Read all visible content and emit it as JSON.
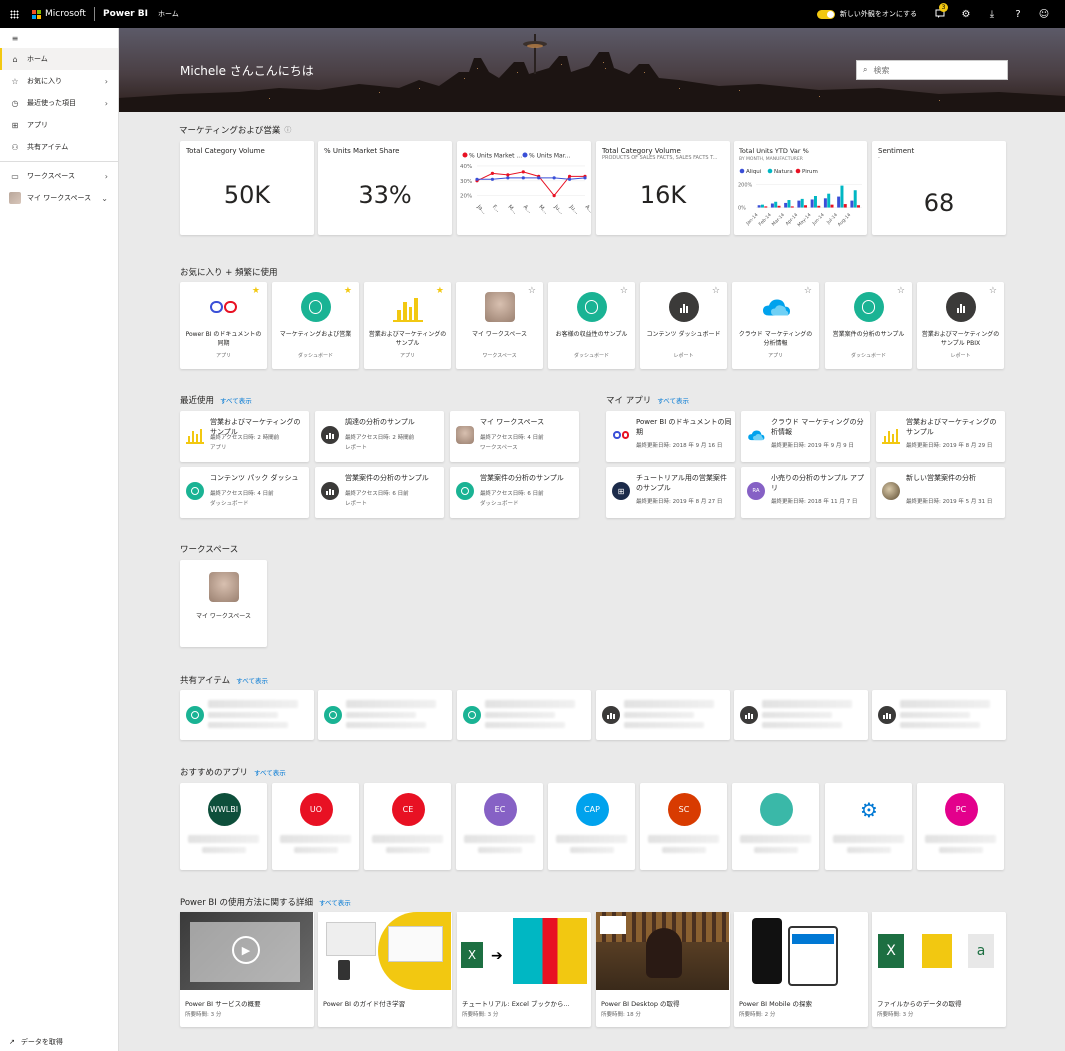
{
  "topbar": {
    "brand": "Microsoft",
    "product": "Power BI",
    "location": "ホーム",
    "new_look_label": "新しい外観をオンにする",
    "notification_count": "3"
  },
  "sidebar": {
    "items": [
      {
        "label": "ホーム",
        "icon": "home-icon"
      },
      {
        "label": "お気に入り",
        "icon": "star-icon"
      },
      {
        "label": "最近使った項目",
        "icon": "clock-icon"
      },
      {
        "label": "アプリ",
        "icon": "apps-icon"
      },
      {
        "label": "共有アイテム",
        "icon": "shared-icon"
      },
      {
        "label": "ワークスペース",
        "icon": "workspace-icon"
      },
      {
        "label": "マイ ワークスペース",
        "icon": "avatar"
      }
    ],
    "get_data": "データを取得"
  },
  "banner": {
    "greeting": "Michele さんこんにちは",
    "search_placeholder": "検索"
  },
  "kpi_section": {
    "title": "マーケティングおよび営業",
    "cards": [
      {
        "title": "Total Category Volume",
        "value": "50K"
      },
      {
        "title": "% Units Market Share",
        "value": "33%"
      },
      {
        "title": "Total Category Volume",
        "subtitle": "PRODUCTS OF SALES FACTS, SALES FACTS T...",
        "value": "16K"
      },
      {
        "title": "Sentiment",
        "subtitle": "-",
        "value": "68"
      }
    ]
  },
  "chart_data": [
    {
      "type": "line",
      "legend": [
        "% Units Market ...",
        "% Units Mar..."
      ],
      "categories": [
        "Ja...",
        "F...",
        "M...",
        "A...",
        "M...",
        "Ju...",
        "Ju...",
        "A..."
      ],
      "yticks": [
        "40%",
        "30%",
        "20%"
      ],
      "series": [
        {
          "name": "% Units Market ...",
          "color": "#e81123",
          "values": [
            30,
            35,
            34,
            36,
            33,
            20,
            33,
            33
          ]
        },
        {
          "name": "% Units Mar...",
          "color": "#3a4fd7",
          "values": [
            31,
            31,
            32,
            32,
            32,
            32,
            31,
            32
          ]
        }
      ],
      "ylim": [
        15,
        42
      ]
    },
    {
      "type": "bar",
      "title": "Total Units YTD Var %",
      "subtitle": "BY MONTH, MANUFACTURER",
      "legend": [
        "Aliqui",
        "Natura",
        "Pirum"
      ],
      "yticks": [
        "200%",
        "0%"
      ],
      "categories": [
        "Jan-14",
        "Feb-14",
        "Mar-14",
        "Apr-14",
        "May-14",
        "Jun-14",
        "Jul-14",
        "Aug-14"
      ],
      "series": [
        {
          "name": "Aliqui",
          "color": "#3a4fd7",
          "values": [
            20,
            35,
            40,
            60,
            70,
            80,
            95,
            60
          ]
        },
        {
          "name": "Natura",
          "color": "#00b7c3",
          "values": [
            25,
            50,
            65,
            75,
            100,
            120,
            190,
            150
          ]
        },
        {
          "name": "Pirum",
          "color": "#e81123",
          "values": [
            10,
            15,
            10,
            20,
            15,
            25,
            30,
            20
          ]
        }
      ],
      "ylim": [
        -30,
        230
      ]
    }
  ],
  "favorites": {
    "title": "お気に入り + 頻繁に使用",
    "items": [
      {
        "name": "Power BI のドキュメントの同期",
        "type": "アプリ",
        "starred": true,
        "icon": "stopwatch-icon"
      },
      {
        "name": "マーケティングおよび営業",
        "type": "ダッシュボード",
        "starred": true,
        "icon": "gauge-icon"
      },
      {
        "name": "営業およびマーケティングのサンプル",
        "type": "アプリ",
        "starred": true,
        "icon": "chart-yellow-icon"
      },
      {
        "name": "マイ ワークスペース",
        "type": "ワークスペース",
        "starred": false,
        "icon": "avatar"
      },
      {
        "name": "お客様の収益性のサンプル",
        "type": "ダッシュボード",
        "starred": false,
        "icon": "gauge-icon"
      },
      {
        "name": "コンテンツ ダッシュボード",
        "type": "レポート",
        "starred": false,
        "icon": "report-icon"
      },
      {
        "name": "クラウド マーケティングの分析情報",
        "type": "アプリ",
        "starred": false,
        "icon": "cloud-icon"
      },
      {
        "name": "営業案件の分析のサンプル",
        "type": "ダッシュボード",
        "starred": false,
        "icon": "gauge-icon"
      },
      {
        "name": "営業およびマーケティングのサンプル PBIX",
        "type": "レポート",
        "starred": false,
        "icon": "report-icon"
      }
    ]
  },
  "recent": {
    "title": "最近使用",
    "see_all": "すべて表示",
    "items": [
      {
        "name": "営業およびマーケティングのサンプル",
        "meta": "最終アクセス日時: 2 時間前",
        "type": "アプリ",
        "icon": "chart-yellow-icon"
      },
      {
        "name": "調達の分析のサンプル",
        "meta": "最終アクセス日時: 2 時間前",
        "type": "レポート",
        "icon": "report-icon"
      },
      {
        "name": "マイ ワークスペース",
        "meta": "最終アクセス日時: 4 日前",
        "type": "ワークスペース",
        "icon": "avatar"
      },
      {
        "name": "コンテンツ パック ダッシュ",
        "meta": "最終アクセス日時: 4 日前",
        "type": "ダッシュボード",
        "icon": "gauge-icon"
      },
      {
        "name": "営業案件の分析のサンプル",
        "meta": "最終アクセス日時: 6 日前",
        "type": "レポート",
        "icon": "report-icon"
      },
      {
        "name": "営業案件の分析のサンプル",
        "meta": "最終アクセス日時: 6 日前",
        "type": "ダッシュボード",
        "icon": "gauge-icon"
      }
    ]
  },
  "myapps": {
    "title": "マイ アプリ",
    "see_all": "すべて表示",
    "items": [
      {
        "name": "Power BI のドキュメントの同期",
        "meta": "最終更新日時: 2018 年 9 月 16 日",
        "icon": "stopwatch-icon"
      },
      {
        "name": "クラウド マーケティングの分析情報",
        "meta": "最終更新日時: 2019 年 9 月 9 日",
        "icon": "cloud-icon"
      },
      {
        "name": "営業およびマーケティングのサンプル",
        "meta": "最終更新日時: 2019 年 8 月 29 日",
        "icon": "chart-yellow-icon"
      },
      {
        "name": "チュートリアル用の営業案件のサンプル",
        "meta": "最終更新日時: 2019 年 8 月 27 日",
        "icon": "grid-icon"
      },
      {
        "name": "小売りの分析のサンプル アプリ",
        "meta": "最終更新日時: 2018 年 11 月 7 日",
        "icon": "ra-icon",
        "initials": "RA"
      },
      {
        "name": "新しい営業案件の分析",
        "meta": "最終更新日時: 2019 年 5 月 31 日",
        "icon": "photo-icon"
      }
    ]
  },
  "workspaces": {
    "title": "ワークスペース",
    "items": [
      {
        "name": "マイ ワークスペース"
      }
    ]
  },
  "shared": {
    "title": "共有アイテム",
    "see_all": "すべて表示",
    "icons": [
      "gauge-icon",
      "gauge-icon",
      "gauge-icon",
      "report-icon",
      "report-icon",
      "report-icon"
    ]
  },
  "featured_apps": {
    "title": "おすすめのアプリ",
    "see_all": "すべて表示",
    "items": [
      {
        "initials": "WWLBI",
        "color": "#0e4f3b"
      },
      {
        "initials": "UO",
        "color": "#e81123"
      },
      {
        "initials": "CE",
        "color": "#e81123"
      },
      {
        "initials": "EC",
        "color": "#8661c5"
      },
      {
        "initials": "CAP",
        "color": "#00a2ed"
      },
      {
        "initials": "SC",
        "color": "#d83b01"
      },
      {
        "initials": "",
        "color": "#3ab8a8"
      },
      {
        "initials": "",
        "color": "#ffffff"
      },
      {
        "initials": "PC",
        "color": "#e3008c"
      }
    ]
  },
  "learning": {
    "title": "Power BI の使用方法に関する詳細",
    "see_all": "すべて表示",
    "items": [
      {
        "title": "Power BI サービスの概要",
        "duration": "所要時間: 3 分"
      },
      {
        "title": "Power BI のガイド付き学習",
        "duration": ""
      },
      {
        "title": "チュートリアル: Excel ブックから...",
        "duration": "所要時間: 3 分"
      },
      {
        "title": "Power BI Desktop の取得",
        "duration": "所要時間: 18 分"
      },
      {
        "title": "Power BI Mobile の探索",
        "duration": "所要時間: 2 分"
      },
      {
        "title": "ファイルからのデータの取得",
        "duration": "所要時間: 3 分"
      }
    ]
  }
}
